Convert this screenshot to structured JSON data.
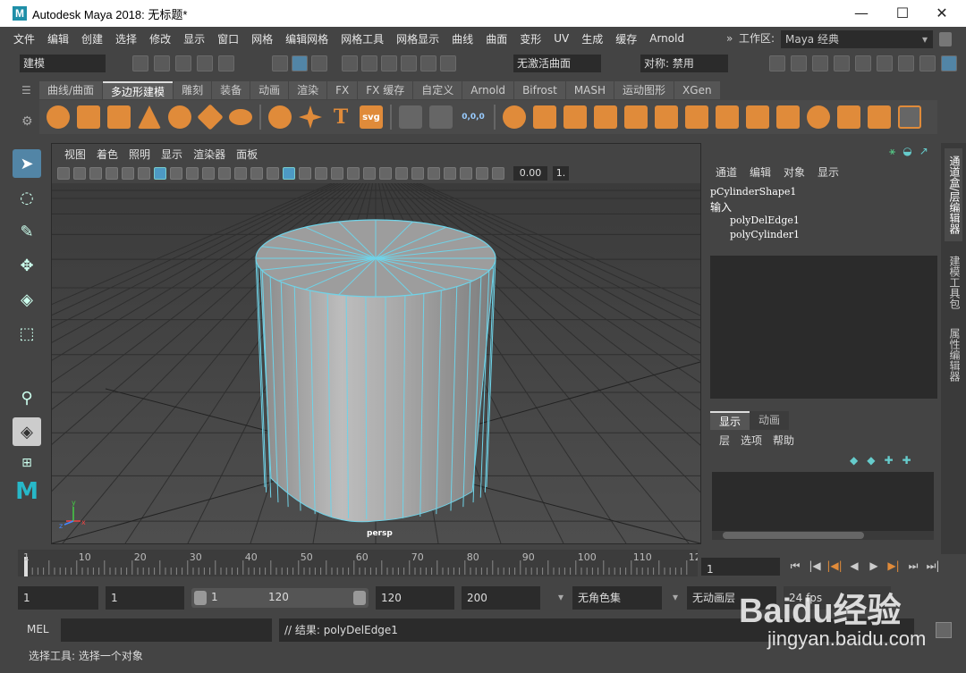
{
  "window": {
    "title": "Autodesk Maya 2018: 无标题*",
    "logo_letter": "M",
    "minimize": "—",
    "maximize": "☐",
    "close": "✕"
  },
  "menubar": {
    "items": [
      "文件",
      "编辑",
      "创建",
      "选择",
      "修改",
      "显示",
      "窗口",
      "网格",
      "编辑网格",
      "网格工具",
      "网格显示",
      "曲线",
      "曲面",
      "变形",
      "UV",
      "生成",
      "缓存",
      "Arnold"
    ],
    "workspace_label": "工作区:",
    "workspace_value": "Maya 经典",
    "expand_glyph": "»"
  },
  "statusline": {
    "mode_value": "建模",
    "live_surface": "无激活曲面",
    "symmetry": "对称: 禁用"
  },
  "shelf": {
    "tabs": [
      "曲线/曲面",
      "多边形建模",
      "雕刻",
      "装备",
      "动画",
      "渲染",
      "FX",
      "FX 缓存",
      "自定义",
      "Arnold",
      "Bifrost",
      "MASH",
      "运动图形",
      "XGen"
    ],
    "active_tab": "多边形建模",
    "icons": [
      "poly-sphere",
      "poly-cube",
      "poly-cylinder",
      "poly-cone",
      "poly-torus",
      "poly-plane",
      "poly-disc",
      "platonic",
      "super-shape",
      "type-text",
      "svg",
      "measure",
      "mirror",
      "combine",
      "separate",
      "extract",
      "smooth",
      "bool",
      "extrude",
      "bridge",
      "bevel",
      "append",
      "fill-hole",
      "multi-cut",
      "poly-target",
      "insert-loop",
      "offset-loop"
    ],
    "text_icon_T": "T",
    "svg_label": "svg",
    "coords_label": "0,0,0"
  },
  "toolbox": {
    "tools": [
      "select-tool",
      "lasso-tool",
      "paint-select-tool",
      "move-tool",
      "rotate-tool",
      "scale-tool",
      "show-manipulator",
      "layout-single",
      "layout-four",
      "layout-two"
    ]
  },
  "viewport": {
    "menu": [
      "视图",
      "着色",
      "照明",
      "显示",
      "渲染器",
      "面板"
    ],
    "exposure_value": "0.00",
    "gamma_value": "1.",
    "camera_label": "persp",
    "axis_x": "x",
    "axis_y": "y",
    "axis_z": "z"
  },
  "channel_box": {
    "menu": [
      "通道",
      "编辑",
      "对象",
      "显示"
    ],
    "shape_node": "pCylinderShape1",
    "inputs_label": "输入",
    "inputs": [
      "polyDelEdge1",
      "polyCylinder1"
    ]
  },
  "layer_editor": {
    "tabs": [
      "显示",
      "动画"
    ],
    "active_tab": "显示",
    "menu": [
      "层",
      "选项",
      "帮助"
    ]
  },
  "side_tabs": [
    "通道盒/层编辑器",
    "建模工具包",
    "属性编辑器"
  ],
  "timeline": {
    "ticks": [
      "1",
      "10",
      "20",
      "30",
      "40",
      "50",
      "60",
      "70",
      "80",
      "90",
      "100",
      "110",
      "12"
    ],
    "current_frame": "1"
  },
  "playback": {
    "buttons": [
      "⏮",
      "|◀",
      "|◀|",
      "◀",
      "▶",
      "▶|",
      "⏭",
      "⏭|"
    ]
  },
  "range": {
    "start": "1",
    "anim_start": "1",
    "slider_start": "1",
    "slider_end": "120",
    "end": "120",
    "anim_end": "200",
    "character_set": "无角色集",
    "anim_layer": "无动画层",
    "fps": "24 fps"
  },
  "command_line": {
    "language": "MEL",
    "input": "",
    "result": "// 结果: polyDelEdge1"
  },
  "help_line": {
    "text": "选择工具: 选择一个对象"
  },
  "watermark": {
    "brand": "Baidu经验",
    "url": "jingyan.baidu.com"
  },
  "colors": {
    "accent": "#5285a6",
    "shelf_icon": "#e08b3a",
    "wire": "#6fd3e8",
    "bg": "#444444"
  }
}
